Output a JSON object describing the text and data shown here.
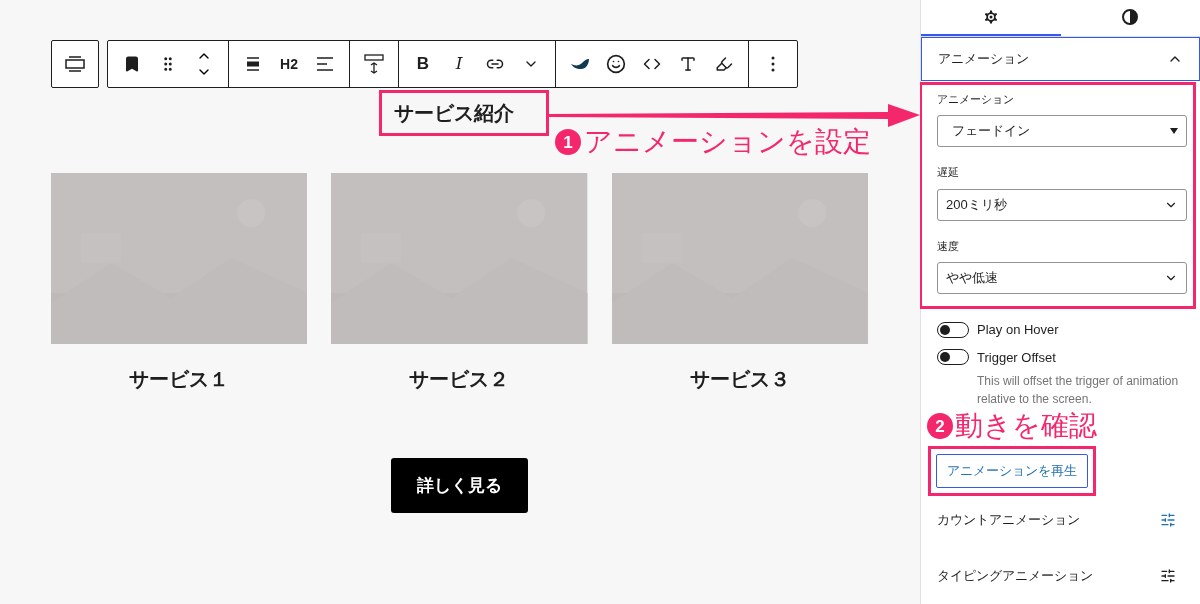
{
  "toolbar": {
    "heading_level": "H2",
    "bold": "B",
    "italic": "I"
  },
  "content": {
    "heading": "サービス紹介",
    "cards": [
      {
        "caption": "サービス１",
        "kind": "picture"
      },
      {
        "caption": "サービス２",
        "kind": "picture"
      },
      {
        "caption": "サービス３",
        "kind": "picture"
      }
    ],
    "button": "詳しく見る"
  },
  "annotations": [
    {
      "number": "1",
      "text": "アニメーションを設定"
    },
    {
      "number": "2",
      "text": "動きを確認"
    }
  ],
  "sidebar": {
    "tabs": [
      {
        "selected": true
      },
      {
        "selected": false
      }
    ],
    "panel": {
      "title": "アニメーション",
      "expanded": true
    },
    "fields": [
      {
        "label": "アニメーション",
        "value": "フェードイン",
        "kind": "native"
      },
      {
        "label": "遅延",
        "value": "200ミリ秒",
        "kind": "custom"
      },
      {
        "label": "速度",
        "value": "やや低速",
        "kind": "custom"
      }
    ],
    "toggles": [
      {
        "label": "Play on Hover",
        "on": false
      },
      {
        "label": "Trigger Offset",
        "on": false,
        "help": "This will offset the trigger of animation relative to the screen."
      }
    ],
    "play_button": "アニメーションを再生",
    "subpanels": [
      {
        "title": "カウントアニメーション",
        "active": true
      },
      {
        "title": "タイピングアニメーション",
        "active": false
      }
    ]
  }
}
